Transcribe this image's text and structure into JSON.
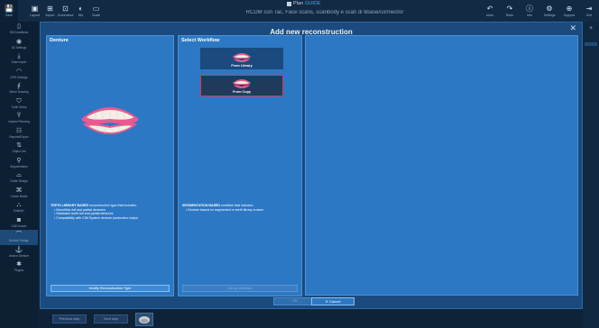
{
  "app": {
    "logo_prefix": "Plan",
    "logo_suffix": "GUIDE",
    "project_title": "RCDM con Tac, Face scans, scanbody e scan di tibase/connector"
  },
  "toolbar_left": [
    {
      "icon": "save-icon",
      "glyph": "💾",
      "label": "Save"
    },
    {
      "icon": "layout-icon",
      "glyph": "▣",
      "label": "Layout"
    },
    {
      "icon": "import-icon",
      "glyph": "⊞",
      "label": "Import"
    },
    {
      "icon": "screenshot-icon",
      "glyph": "⊡",
      "label": "Screenshot"
    },
    {
      "icon": "contrast-icon",
      "glyph": "◐",
      "label": "Mix"
    },
    {
      "icon": "rectangle-icon",
      "glyph": "▭",
      "label": "Scale"
    }
  ],
  "toolbar_right": [
    {
      "icon": "undo-icon",
      "glyph": "↶",
      "label": "Undo"
    },
    {
      "icon": "redo-icon",
      "glyph": "↷",
      "label": "Redo"
    },
    {
      "icon": "info-icon",
      "glyph": "ⓘ",
      "label": "Info"
    },
    {
      "icon": "settings-icon",
      "glyph": "⚙",
      "label": "Settings"
    },
    {
      "icon": "globe-icon",
      "glyph": "⊕",
      "label": "Support"
    },
    {
      "icon": "exit-icon",
      "glyph": "⇥",
      "label": "Exit"
    }
  ],
  "sidebar": [
    {
      "icon": "dicom-icon",
      "glyph": "▯",
      "label": "3D/2 Additions"
    },
    {
      "icon": "3d-settings-icon",
      "glyph": "◉",
      "label": "3D Settings"
    },
    {
      "icon": "data-import-icon",
      "glyph": "⤓",
      "label": "Data Import"
    },
    {
      "icon": "opg-icon",
      "glyph": "◠",
      "label": "OPG Settings"
    },
    {
      "icon": "nerve-icon",
      "glyph": "∮",
      "label": "Nerve Drawing"
    },
    {
      "icon": "tooth-icon",
      "glyph": "⛉",
      "label": "Tooth Setup"
    },
    {
      "icon": "implant-icon",
      "glyph": "Ÿ",
      "label": "Implant Planning"
    },
    {
      "icon": "reports-icon",
      "glyph": "☷",
      "label": "Reports/Export"
    },
    {
      "icon": "object-list-icon",
      "glyph": "⇅",
      "label": "Object List"
    },
    {
      "icon": "segmentation-icon",
      "glyph": "⚲",
      "label": "Segmentation"
    },
    {
      "icon": "guide-design-icon",
      "glyph": "⌓",
      "label": "Guide Design"
    },
    {
      "icon": "crown-model-icon",
      "glyph": "⌘",
      "label": "Crown Model"
    },
    {
      "icon": "smilefy-icon",
      "glyph": "⛬",
      "label": "Smilefy+"
    },
    {
      "icon": "cad-import-icon",
      "glyph": "◙",
      "label": "CAD Import"
    },
    {
      "icon": "denture-icon",
      "glyph": "⌒",
      "label": "Denture Design",
      "active": true
    },
    {
      "icon": "anchor-icon",
      "glyph": "⚓",
      "label": "Anchor Denture"
    },
    {
      "icon": "plugins-icon",
      "glyph": "✱",
      "label": "Plugins"
    }
  ],
  "dialog": {
    "title": "Add new reconstruction",
    "close_glyph": "✕",
    "ok_label": "OK",
    "cancel_label": "Cancel",
    "cancel_glyph": "✕"
  },
  "denture_panel": {
    "title": "Denture",
    "desc_strong": "TEETH LIBRARY BASED",
    "desc_rest": " reconstruction type that includes:",
    "bullets": [
      "Monolithic full and partial dentures",
      "Stackable teeth full and partial dentures",
      "Compatibility with CIM System denture production output"
    ],
    "modify_button": "Modify Reconstruction Type"
  },
  "workflow_panel": {
    "title": "Select Workflow",
    "options": [
      {
        "label": "From Library",
        "selected": false
      },
      {
        "label": "From Copy",
        "selected": true
      }
    ],
    "desc_strong": "SEGMENTATION BASED",
    "desc_rest": " workflow that includes:",
    "bullets": [
      "Denture based on segmented or teeth library crowns"
    ],
    "bottom_button": "Set as Workflow"
  },
  "bottom_bar": {
    "prev_label": "Previous step",
    "next_label": "Next step"
  },
  "colors": {
    "dialog_bg": "#1a4a7e",
    "panel_bg": "#2c78c4",
    "selection_border": "#e0354a",
    "gum_pink": "#e85b8f",
    "teeth": "#f2efe6"
  }
}
